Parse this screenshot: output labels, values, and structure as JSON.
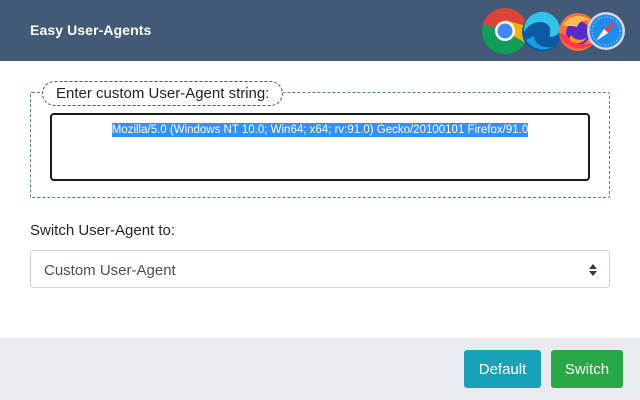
{
  "header": {
    "title": "Easy User-Agents",
    "browser_icons": [
      "chrome-icon",
      "edge-icon",
      "firefox-icon",
      "safari-icon"
    ]
  },
  "custom": {
    "legend": "Enter custom User-Agent string:",
    "value": "Mozilla/5.0 (Windows NT 10.0; Win64; x64; rv:91.0) Gecko/20100101 Firefox/91.0"
  },
  "switch": {
    "label": "Switch User-Agent to:",
    "selected": "Custom User-Agent"
  },
  "buttons": {
    "default_label": "Default",
    "switch_label": "Switch"
  },
  "colors": {
    "header_bg": "#425a78",
    "default_btn": "#17a2b8",
    "switch_btn": "#28a745",
    "selection": "#3390ff"
  }
}
